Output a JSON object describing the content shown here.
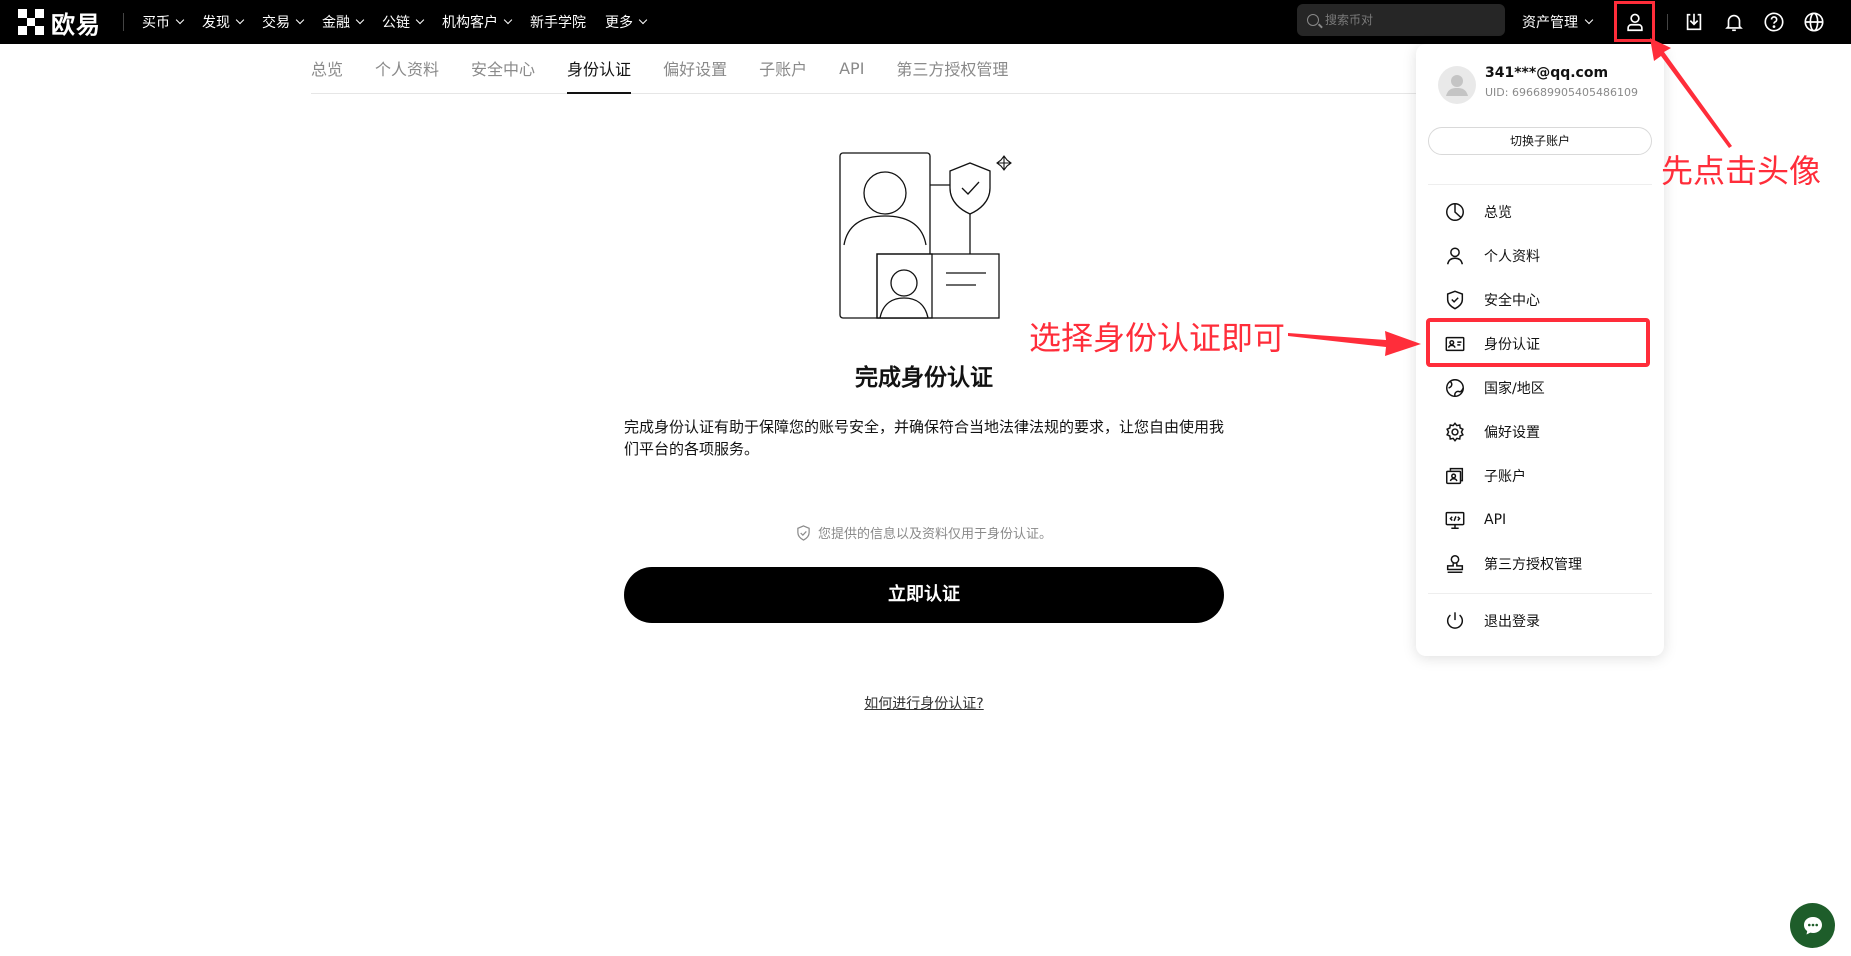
{
  "brand": {
    "name": "欧易"
  },
  "nav": [
    {
      "label": "买币",
      "has_menu": true
    },
    {
      "label": "发现",
      "has_menu": true
    },
    {
      "label": "交易",
      "has_menu": true
    },
    {
      "label": "金融",
      "has_menu": true
    },
    {
      "label": "公链",
      "has_menu": true
    },
    {
      "label": "机构客户",
      "has_menu": true
    },
    {
      "label": "新手学院",
      "has_menu": false
    },
    {
      "label": "更多",
      "has_menu": true
    }
  ],
  "search": {
    "placeholder": "搜索币对"
  },
  "header": {
    "asset_label": "资产管理"
  },
  "top_icons": [
    "user-icon",
    "download-icon",
    "bell-icon",
    "help-icon",
    "globe-icon"
  ],
  "tabs": [
    {
      "label": "总览",
      "active": false
    },
    {
      "label": "个人资料",
      "active": false
    },
    {
      "label": "安全中心",
      "active": false
    },
    {
      "label": "身份认证",
      "active": true
    },
    {
      "label": "偏好设置",
      "active": false
    },
    {
      "label": "子账户",
      "active": false
    },
    {
      "label": "API",
      "active": false
    },
    {
      "label": "第三方授权管理",
      "active": false
    }
  ],
  "main": {
    "title": "完成身份认证",
    "description": "完成身份认证有助于保障您的账号安全，并确保符合当地法律法规的要求，让您自由使用我们平台的各项服务。",
    "note": "您提供的信息以及资料仅用于身份认证。",
    "button": "立即认证",
    "help_link": "如何进行身份认证?"
  },
  "dropdown": {
    "email": "341***@qq.com",
    "uid": "UID: 696689905405486109",
    "switch_label": "切换子账户",
    "items": [
      {
        "label": "总览",
        "icon": "pie-chart-icon"
      },
      {
        "label": "个人资料",
        "icon": "person-icon"
      },
      {
        "label": "安全中心",
        "icon": "shield-icon"
      },
      {
        "label": "身份认证",
        "icon": "id-card-icon",
        "highlighted": true
      },
      {
        "label": "国家/地区",
        "icon": "globe-region-icon"
      },
      {
        "label": "偏好设置",
        "icon": "gear-icon"
      },
      {
        "label": "子账户",
        "icon": "sub-account-icon"
      },
      {
        "label": "API",
        "icon": "api-icon"
      },
      {
        "label": "第三方授权管理",
        "icon": "stamp-icon"
      }
    ],
    "logout_label": "退出登录"
  },
  "annotations": {
    "click_avatar": "先点击头像",
    "choose_identity": "选择身份认证即可"
  },
  "colors": {
    "annotation": "#ff2d3a",
    "topbar": "#000000",
    "chat": "#1e5d2a"
  }
}
